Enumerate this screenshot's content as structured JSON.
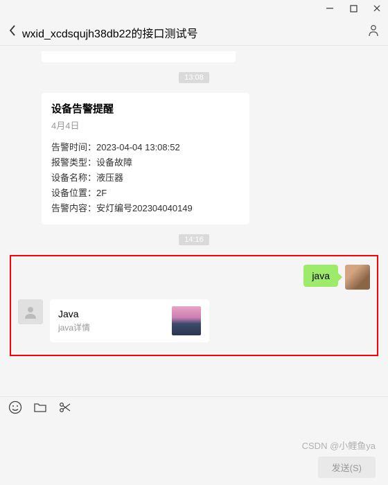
{
  "header": {
    "title": "wxid_xcdsqujh38db22的接口测试号"
  },
  "chat": {
    "time1": "13:08",
    "time2": "14:16",
    "alert_card": {
      "title": "设备告警提醒",
      "date": "4月4日",
      "rows": [
        "告警时间：2023-04-04 13:08:52",
        "报警类型：设备故障",
        "设备名称：液压器",
        "设备位置：2F",
        "告警内容：安灯编号202304040149"
      ]
    },
    "sent_msg": "java",
    "reply": {
      "title": "Java",
      "subtitle": "java详情"
    }
  },
  "footer": {
    "send_label": "发送(S)"
  },
  "watermark": "CSDN @小鲤鱼ya"
}
